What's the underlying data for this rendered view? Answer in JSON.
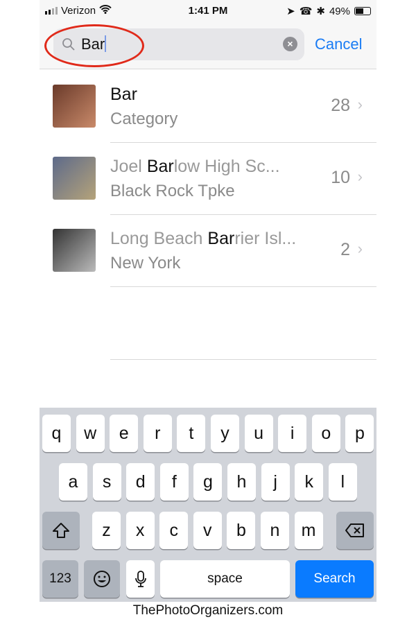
{
  "status": {
    "carrier": "Verizon",
    "time": "1:41 PM",
    "battery": "49%",
    "battery_level": 0.49
  },
  "search": {
    "value": "Bar",
    "cancel_label": "Cancel"
  },
  "results": [
    {
      "pre": "",
      "match": "Bar",
      "post": "",
      "subtitle": "Category",
      "count": "28",
      "thumb_colors": [
        "#6a3a2a",
        "#c98a6a"
      ]
    },
    {
      "pre": "Joel ",
      "match": "Bar",
      "post": "low High Sc...",
      "subtitle": "Black Rock Tpke",
      "count": "10",
      "thumb_colors": [
        "#5d6a8a",
        "#b5a37a"
      ]
    },
    {
      "pre": "Long Beach ",
      "match": "Bar",
      "post": "rier Isl...",
      "subtitle": "New York",
      "count": "2",
      "thumb_colors": [
        "#333333",
        "#bbbbbb"
      ]
    }
  ],
  "keyboard": {
    "row1": [
      "q",
      "w",
      "e",
      "r",
      "t",
      "y",
      "u",
      "i",
      "o",
      "p"
    ],
    "row2": [
      "a",
      "s",
      "d",
      "f",
      "g",
      "h",
      "j",
      "k",
      "l"
    ],
    "row3": [
      "z",
      "x",
      "c",
      "v",
      "b",
      "n",
      "m"
    ],
    "numbers_label": "123",
    "space_label": "space",
    "search_label": "Search"
  },
  "footer": "ThePhotoOrganizers.com",
  "colors": {
    "accent": "#1a7cf4",
    "annotation": "#e02a1a"
  }
}
